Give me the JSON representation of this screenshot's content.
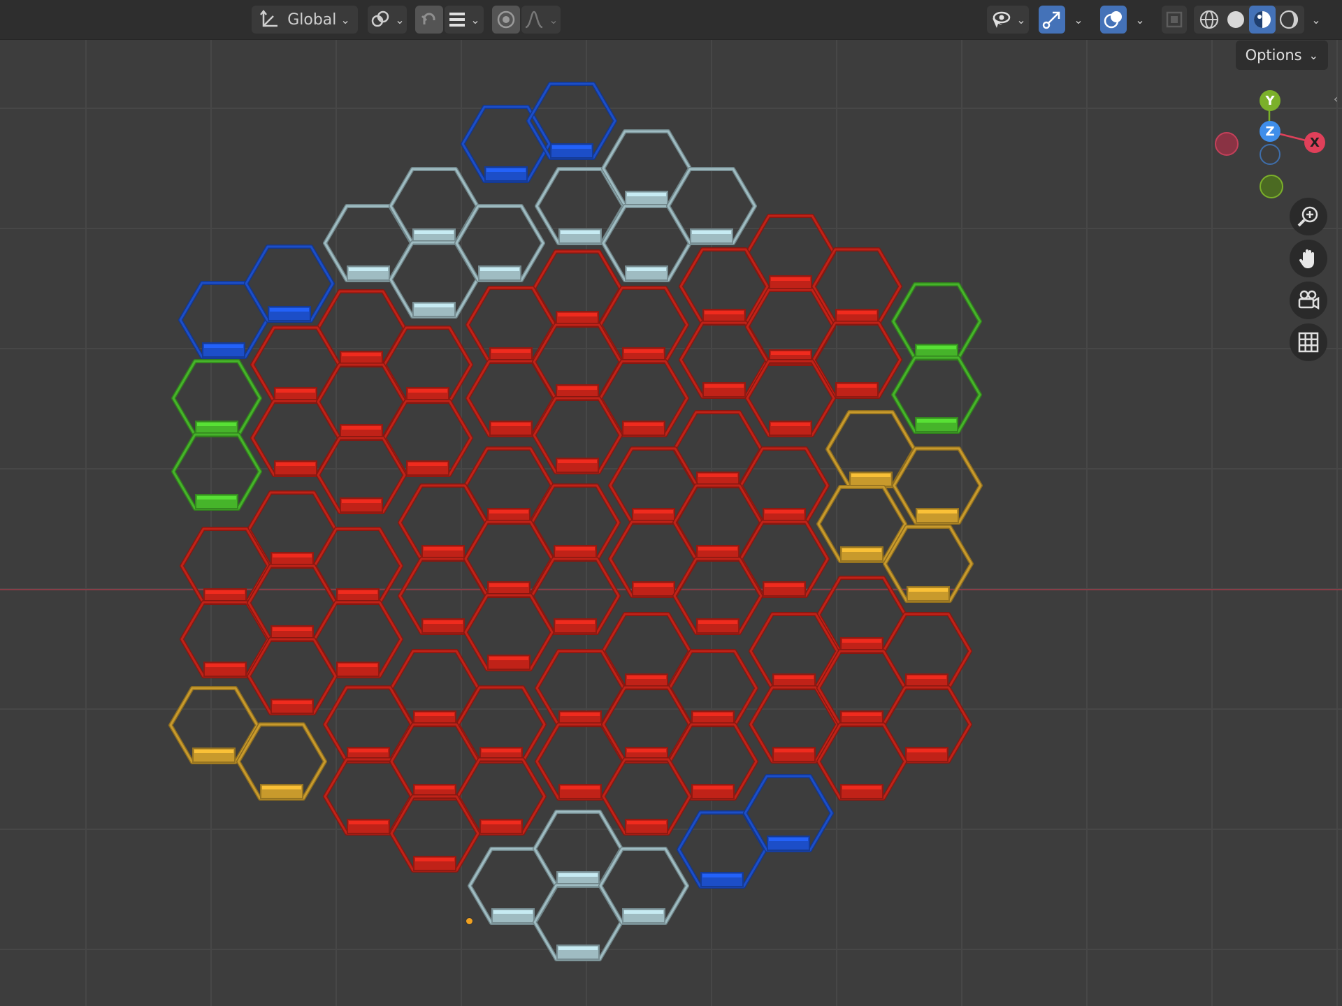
{
  "header": {
    "orientation": {
      "label": "Global",
      "icon": "transform-orientation-icon"
    },
    "pivot": {
      "icon": "pivot-point-icon"
    },
    "snap": {
      "icon": "snap-magnet-icon",
      "settings_icon": "snap-increment-icon"
    },
    "proportional": {
      "icon": "proportional-editing-icon",
      "falloff_icon": "falloff-curve-icon"
    },
    "visibility": {
      "icon": "selectability-visibility-icon"
    },
    "gizmo": {
      "icon": "gizmo-toggle-icon"
    },
    "overlays": {
      "icon": "overlays-icon"
    },
    "xray": {
      "icon": "xray-icon"
    },
    "shading": {
      "modes": [
        "wireframe",
        "solid",
        "material-preview",
        "rendered"
      ],
      "active": "material-preview"
    }
  },
  "options": {
    "label": "Options"
  },
  "axis_gizmo": {
    "labels": {
      "y": "Y",
      "z": "Z",
      "x": "X"
    },
    "colors": {
      "x": "#e0405a",
      "y": "#7bb02a",
      "z": "#3f8eea"
    }
  },
  "navigation": [
    "zoom-icon",
    "pan-hand-icon",
    "camera-view-icon",
    "grid-ortho-icon"
  ],
  "hex_colors": {
    "red": "#c02218",
    "blue": "#1c4ec8",
    "grey": "#9fbcc2",
    "green": "#46b42a",
    "yellow": "#c89a2c"
  },
  "hex_groups": [
    {
      "color": "blue",
      "count": 2
    },
    {
      "color": "grey",
      "count": 4
    },
    {
      "color": "grey",
      "count": 4
    },
    {
      "color": "blue",
      "count": 2
    },
    {
      "color": "green",
      "count": 2
    },
    {
      "color": "green",
      "count": 2
    },
    {
      "color": "yellow",
      "count": 4
    },
    {
      "color": "yellow",
      "count": 2
    },
    {
      "color": "blue",
      "count": 2
    },
    {
      "color": "grey",
      "count": 4
    },
    {
      "color": "red",
      "count": 64
    }
  ]
}
